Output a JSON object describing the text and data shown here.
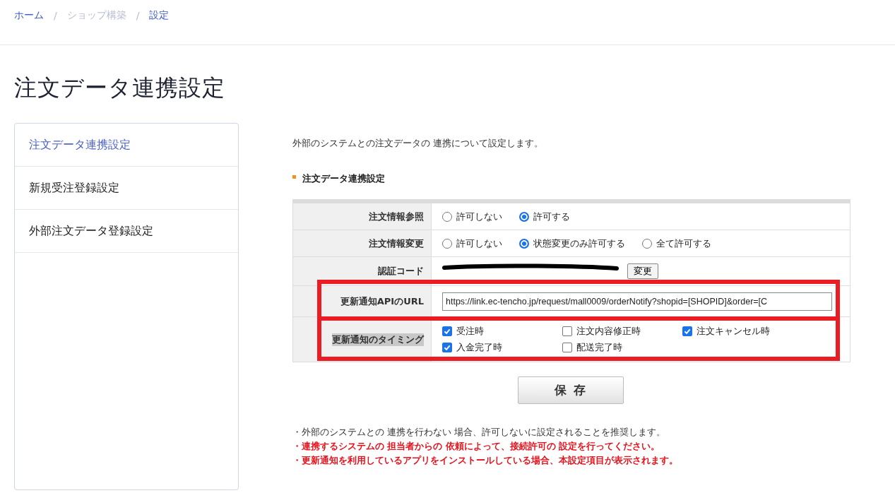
{
  "breadcrumb": [
    {
      "label": "ホーム",
      "kind": "link"
    },
    {
      "label": "ショップ構築",
      "kind": "muted",
      "separator": "/"
    },
    {
      "label": "設定",
      "kind": "link",
      "separator": "/"
    }
  ],
  "page_title": "注文データ連携設定",
  "sidebar": {
    "items": [
      {
        "label": "注文データ連携設定",
        "selected": true
      },
      {
        "label": "新規受注登録設定",
        "selected": false
      },
      {
        "label": "外部注文データ登録設定",
        "selected": false
      }
    ]
  },
  "description": "外部のシステムとの注文データの 連携について設定します。",
  "section_title": "注文データ連携設定",
  "settings": [
    {
      "kind": "radio",
      "label": "注文情報参照",
      "highlighted": false,
      "options": [
        {
          "label": "許可しない",
          "selected": false
        },
        {
          "label": "許可する",
          "selected": true
        }
      ]
    },
    {
      "kind": "radio",
      "label": "注文情報変更",
      "highlighted": false,
      "options": [
        {
          "label": "許可しない",
          "selected": false
        },
        {
          "label": "状態変更のみ許可する",
          "selected": true
        },
        {
          "label": "全て許可する",
          "selected": false
        }
      ]
    },
    {
      "kind": "code",
      "label": "認証コード",
      "highlighted": false,
      "redacted": true,
      "button": "変更"
    },
    {
      "kind": "url",
      "label": "更新通知APIのURL",
      "highlighted": true,
      "value": "https://link.ec-tencho.jp/request/mall0009/orderNotify?shopid=[SHOPID]&order=[C"
    },
    {
      "kind": "checkbox",
      "label": "更新通知のタイミング",
      "highlighted": true,
      "label_selected": true,
      "options": [
        {
          "label": "受注時",
          "checked": true
        },
        {
          "label": "注文内容修正時",
          "checked": false
        },
        {
          "label": "注文キャンセル時",
          "checked": true
        },
        {
          "label": "入金完了時",
          "checked": true
        },
        {
          "label": "配送完了時",
          "checked": false
        }
      ]
    }
  ],
  "save_button": "保 存",
  "notes": [
    {
      "text": "・外部のシステムとの 連携を行わない 場合、許可しないに設定されることを推奨します。",
      "kind": "plain"
    },
    {
      "text": "・連携するシステムの 担当者からの 依頼によって、接続許可の 設定を行ってください。",
      "kind": "warning"
    },
    {
      "text": "・更新通知を利用しているアプリをインストールしている場合、本設定項目が表示されます。",
      "kind": "warning"
    }
  ]
}
